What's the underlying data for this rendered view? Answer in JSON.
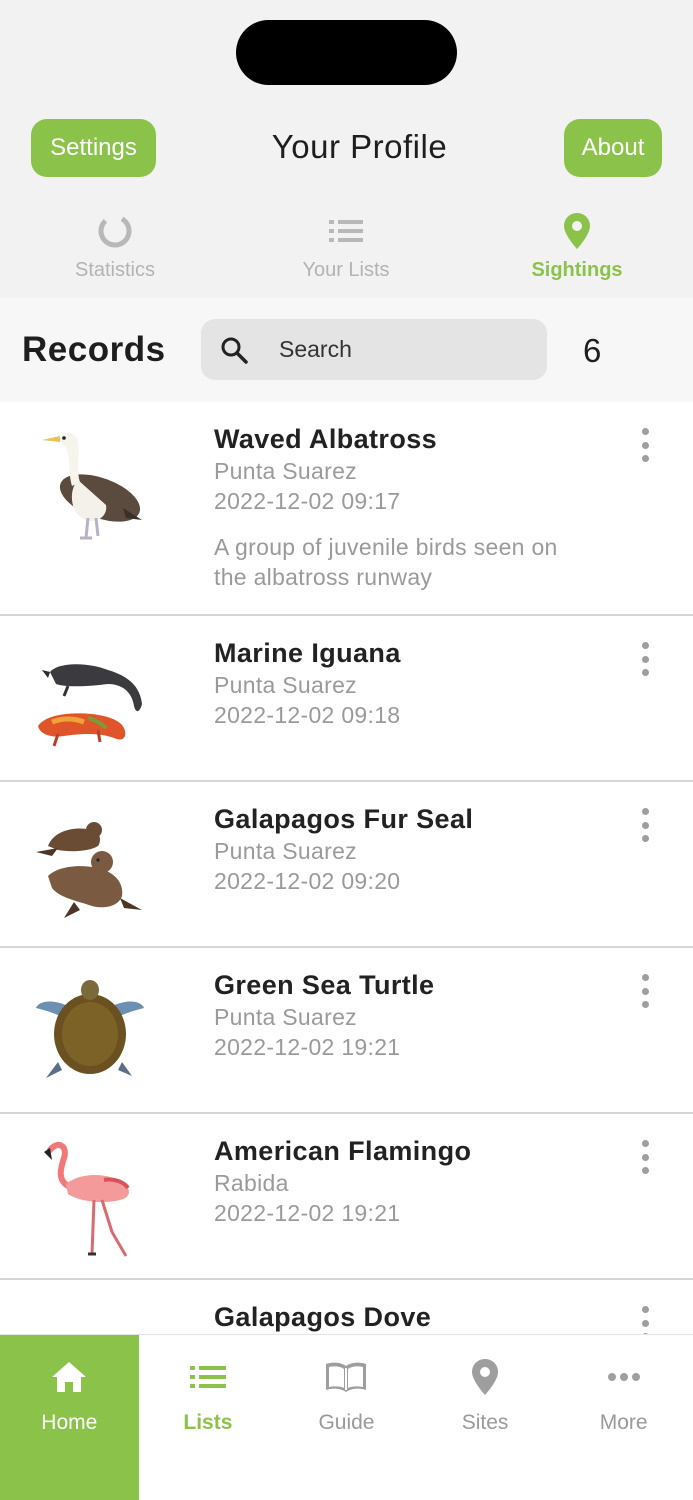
{
  "header": {
    "title": "Your Profile",
    "settings_label": "Settings",
    "about_label": "About"
  },
  "tabs": [
    {
      "label": "Statistics",
      "icon": "circle-progress-icon",
      "active": false
    },
    {
      "label": "Your Lists",
      "icon": "list-icon",
      "active": false
    },
    {
      "label": "Sightings",
      "icon": "map-pin-icon",
      "active": true
    }
  ],
  "records": {
    "title": "Records",
    "search_placeholder": "Search",
    "count": "6"
  },
  "sightings": [
    {
      "name": "Waved Albatross",
      "site": "Punta Suarez",
      "time": "2022-12-02 09:17",
      "note": "A group of juvenile birds seen on the albatross runway",
      "image": "waved-albatross-image"
    },
    {
      "name": "Marine Iguana",
      "site": "Punta Suarez",
      "time": "2022-12-02 09:18",
      "note": "",
      "image": "marine-iguana-image"
    },
    {
      "name": "Galapagos Fur Seal",
      "site": "Punta Suarez",
      "time": "2022-12-02 09:20",
      "note": "",
      "image": "fur-seal-image"
    },
    {
      "name": "Green Sea Turtle",
      "site": "Punta Suarez",
      "time": "2022-12-02 19:21",
      "note": "",
      "image": "sea-turtle-image"
    },
    {
      "name": "American Flamingo",
      "site": "Rabida",
      "time": "2022-12-02 19:21",
      "note": "",
      "image": "flamingo-image"
    },
    {
      "name": "Galapagos Dove",
      "site": "",
      "time": "",
      "note": "",
      "image": "dove-image"
    }
  ],
  "bottom_nav": [
    {
      "label": "Home",
      "icon": "home-icon",
      "active": true
    },
    {
      "label": "Lists",
      "icon": "list-icon"
    },
    {
      "label": "Guide",
      "icon": "book-icon"
    },
    {
      "label": "Sites",
      "icon": "map-pin-icon"
    },
    {
      "label": "More",
      "icon": "more-horizontal-icon"
    }
  ],
  "colors": {
    "accent": "#8bc34a",
    "muted_text": "#9a9a9a",
    "header_bg": "#f2f2f2",
    "search_bg": "#e4e4e4"
  }
}
